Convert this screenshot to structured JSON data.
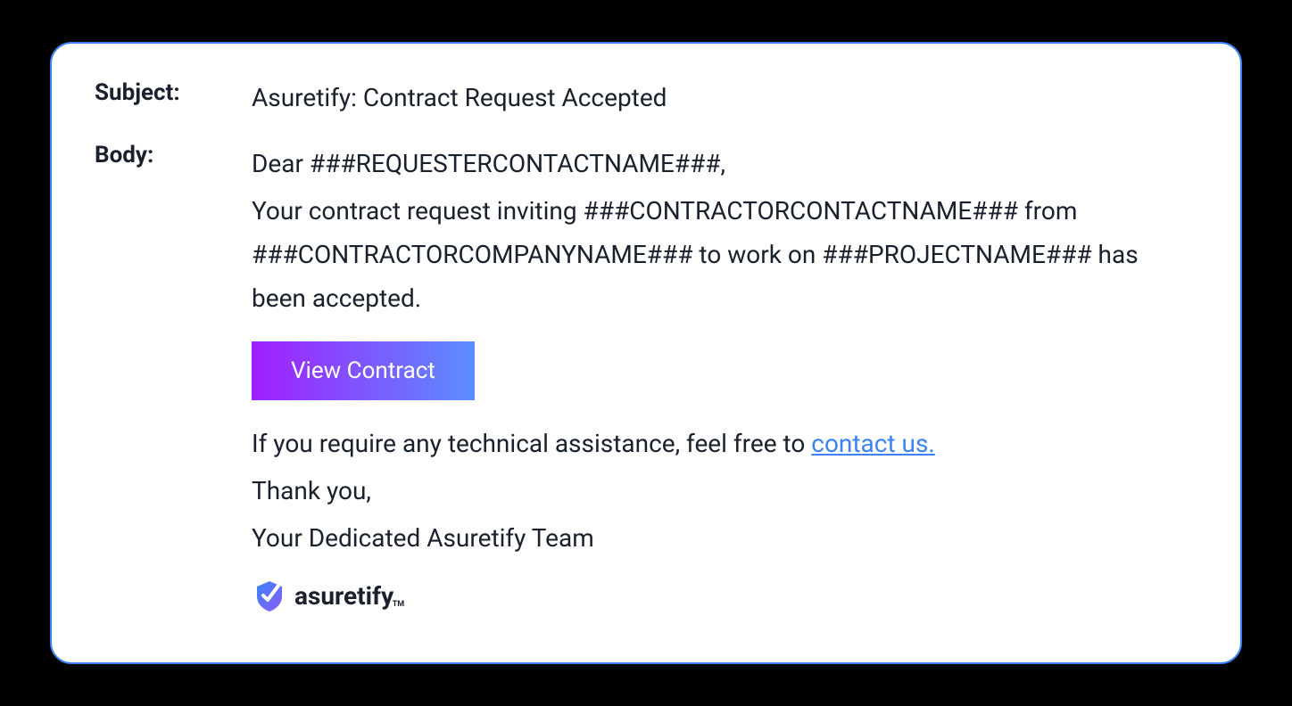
{
  "labels": {
    "subject": "Subject:",
    "body": "Body:"
  },
  "subject": "Asuretify: Contract Request Accepted",
  "body": {
    "greeting": "Dear ###REQUESTERCONTACTNAME###,",
    "main": "Your contract request inviting ###CONTRACTORCONTACTNAME### from ###CONTRACTORCOMPANYNAME### to work on ###PROJECTNAME### has been accepted.",
    "button": "View Contract",
    "assist_prefix": "If you require any technical assistance, feel free to ",
    "assist_link": "contact us.",
    "thank_you": "Thank you,",
    "team": "Your Dedicated Asuretify Team"
  },
  "logo": {
    "text": "asuretify",
    "tm": "TM"
  }
}
